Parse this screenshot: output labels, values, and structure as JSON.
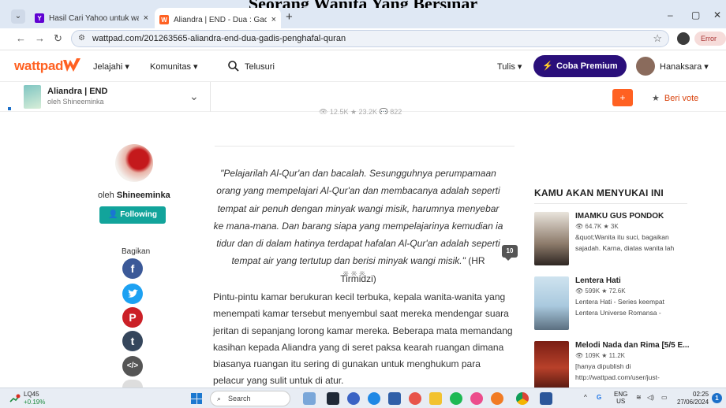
{
  "overlay_title": "Seorang Wanita Yang Bersinar",
  "browser": {
    "tabs": [
      {
        "label": "Hasil Cari Yahoo untuk wattpad",
        "close": "×"
      },
      {
        "label": "Aliandra | END - Dua : Gadis Pe",
        "close": "×"
      }
    ],
    "new_tab": "+",
    "url": "wattpad.com/201263565-aliandra-end-dua-gadis-penghafal-quran",
    "error_label": "Error",
    "minimize": "–",
    "maximize": "▢",
    "close": "✕"
  },
  "header": {
    "logo": "wattpad",
    "nav": [
      "Jelajahi ▾",
      "Komunitas ▾"
    ],
    "search": "Telusuri",
    "tulis": "Tulis ▾",
    "premium": "Coba Premium",
    "username": "Hanaksara ▾"
  },
  "story_bar": {
    "title": "Aliandra | END",
    "author": "oleh Shineeminka",
    "plus": "+",
    "vote": "Beri vote"
  },
  "chapter": {
    "stats": "👁 12.5K   ★ 23.2K   💬 822",
    "author_prefix": "oleh",
    "author_name": "Shineeminka",
    "following": "Following",
    "share_label": "Bagikan",
    "quote": "\"Pelajarilah Al-Qur'an dan bacalah. Sesungguhnya perumpamaan orang yang mempelajari Al-Qur'an dan membacanya adalah seperti tempat air penuh dengan minyak wangi misik, harumnya menyebar ke mana-mana. Dan barang siapa yang mempelajarinya kemudian ia tidur dan di dalam hatinya terdapat hafalan Al-Qur'an adalah seperti tempat air yang tertutup dan berisi minyak wangi misik.\"",
    "quote_source": " (HR Tirmidzi)",
    "comment_count": "10",
    "separator": "※※※",
    "paragraph": "Pintu-pintu kamar berukuran kecil terbuka, kepala wanita-wanita yang menempati kamar tersebut menyembul saat mereka mendengar suara jeritan di sepanjang lorong kamar mereka. Beberapa mata memandang kasihan kepada Aliandra yang di seret paksa kearah ruangan dimana biasanya ruangan itu sering di gunakan untuk menghukum para pelacur yang sulit untuk di atur."
  },
  "recommendations": {
    "title": "KAMU AKAN MENYUKAI INI",
    "items": [
      {
        "title": "IMAMKU GUS PONDOK",
        "stats": "👁 64.7K   ★ 3K",
        "desc": "&quot;Wanita itu suci, bagaikan sajadah. Karna, diatas wanita lah"
      },
      {
        "title": "Lentera Hati",
        "stats": "👁 599K   ★ 72.6K",
        "desc": "Lentera Hati - Series keempat Lentera Universe Romansa -"
      },
      {
        "title": "Melodi Nada dan Rima [5/5 E...",
        "stats": "👁 109K   ★ 11.2K",
        "desc": "[hanya dipublish di http://wattpad.com/user/just-"
      }
    ]
  },
  "taskbar": {
    "ticker": "LQ45",
    "ticker_change": "+0.19%",
    "search": "Search",
    "lang": "ENG",
    "region": "US",
    "time": "02:25",
    "date": "27/06/2024",
    "notifications": "1"
  },
  "colors": {
    "brand": "#ff6122",
    "premium": "#2a0f7a",
    "following": "#12a49b",
    "vote": "#d9440f"
  }
}
